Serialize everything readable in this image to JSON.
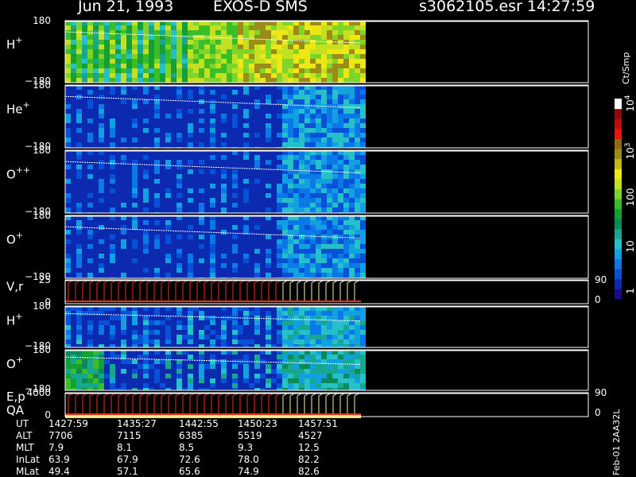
{
  "header": {
    "date": "Jun 21, 1993",
    "mission": "EXOS-D SMS",
    "file": "s3062105.esr",
    "time": "14:27:59"
  },
  "colorbar": {
    "unit": "Ct/Smp",
    "tick_labels": [
      "1",
      "10",
      "100",
      "10",
      "10"
    ],
    "tick_exponents": [
      "",
      "",
      "",
      "3",
      "4"
    ],
    "colors": [
      "#1a0a8a",
      "#0b2ab0",
      "#0750d8",
      "#0b78e8",
      "#13a0e0",
      "#26c0c8",
      "#17a78f",
      "#0e8a5a",
      "#14a036",
      "#3bbd28",
      "#7ed52a",
      "#c4e020",
      "#efe616",
      "#c6b41a",
      "#9a8c16",
      "#8e6b10",
      "#e81410",
      "#bf0c0c",
      "#8a0c0c",
      "#ffffff"
    ]
  },
  "panels": [
    {
      "id": "hplus",
      "label": "H",
      "sup": "+",
      "ymax": "180",
      "ymin": "−180",
      "palette": "hot"
    },
    {
      "id": "heplus",
      "label": "He",
      "sup": "+",
      "ymax": "180",
      "ymin": "−180",
      "palette": "cool"
    },
    {
      "id": "oplusplus",
      "label": "O",
      "sup": "++",
      "ymax": "180",
      "ymin": "−180",
      "palette": "cool"
    },
    {
      "id": "oplus",
      "label": "O",
      "sup": "+",
      "ymax": "180",
      "ymin": "−180",
      "palette": "cool"
    },
    {
      "id": "vr",
      "label": "V,r",
      "sup": "",
      "ymax": "25",
      "ymin": "0",
      "right_top": "90",
      "right_bottom": "0"
    },
    {
      "id": "hplus2",
      "label": "H",
      "sup": "+",
      "ymax": "180",
      "ymin": "−180",
      "palette": "mid"
    },
    {
      "id": "oplus2",
      "label": "O",
      "sup": "+",
      "ymax": "180",
      "ymin": "−180",
      "palette": "green"
    },
    {
      "id": "ep",
      "label": "E,p",
      "label2": "QA",
      "sup": "",
      "ymax": "4000",
      "ymin": "0",
      "right_top": "90",
      "right_bottom": "0"
    }
  ],
  "footer": {
    "rows": [
      {
        "name": "UT",
        "values": [
          "1427:59",
          "1435:27",
          "1442:55",
          "1450:23",
          "1457:51"
        ]
      },
      {
        "name": "ALT",
        "values": [
          "7706",
          "7115",
          "6385",
          "5519",
          "4527"
        ]
      },
      {
        "name": "MLT",
        "values": [
          "7.9",
          "8.1",
          "8.5",
          "9.3",
          "12.5"
        ]
      },
      {
        "name": "InLat",
        "values": [
          "63.9",
          "67.9",
          "72.6",
          "78.0",
          "82.2"
        ]
      },
      {
        "name": "MLat",
        "values": [
          "49.4",
          "57.1",
          "65.6",
          "74.9",
          "82.6"
        ]
      }
    ],
    "stamp": "Feb-01 2AA32L"
  },
  "chart_data": {
    "type": "heatmap",
    "title": "Jun 21, 1993   EXOS-D SMS",
    "x": [
      "1427:59",
      "1435:27",
      "1442:55",
      "1450:23",
      "1457:51"
    ],
    "series": [
      {
        "name": "H+",
        "ylim": [
          -180,
          180
        ]
      },
      {
        "name": "He+",
        "ylim": [
          -180,
          180
        ]
      },
      {
        "name": "O++",
        "ylim": [
          -180,
          180
        ]
      },
      {
        "name": "O+",
        "ylim": [
          -180,
          180
        ]
      },
      {
        "name": "V,r",
        "ylim": [
          0,
          25
        ]
      },
      {
        "name": "H+",
        "ylim": [
          -180,
          180
        ]
      },
      {
        "name": "O+",
        "ylim": [
          -180,
          180
        ]
      },
      {
        "name": "E,p",
        "ylim": [
          0,
          4000
        ]
      }
    ],
    "colorbar_unit": "Ct/Smp",
    "colorbar_range": [
      1,
      10000
    ],
    "colorbar_scale": "log"
  }
}
